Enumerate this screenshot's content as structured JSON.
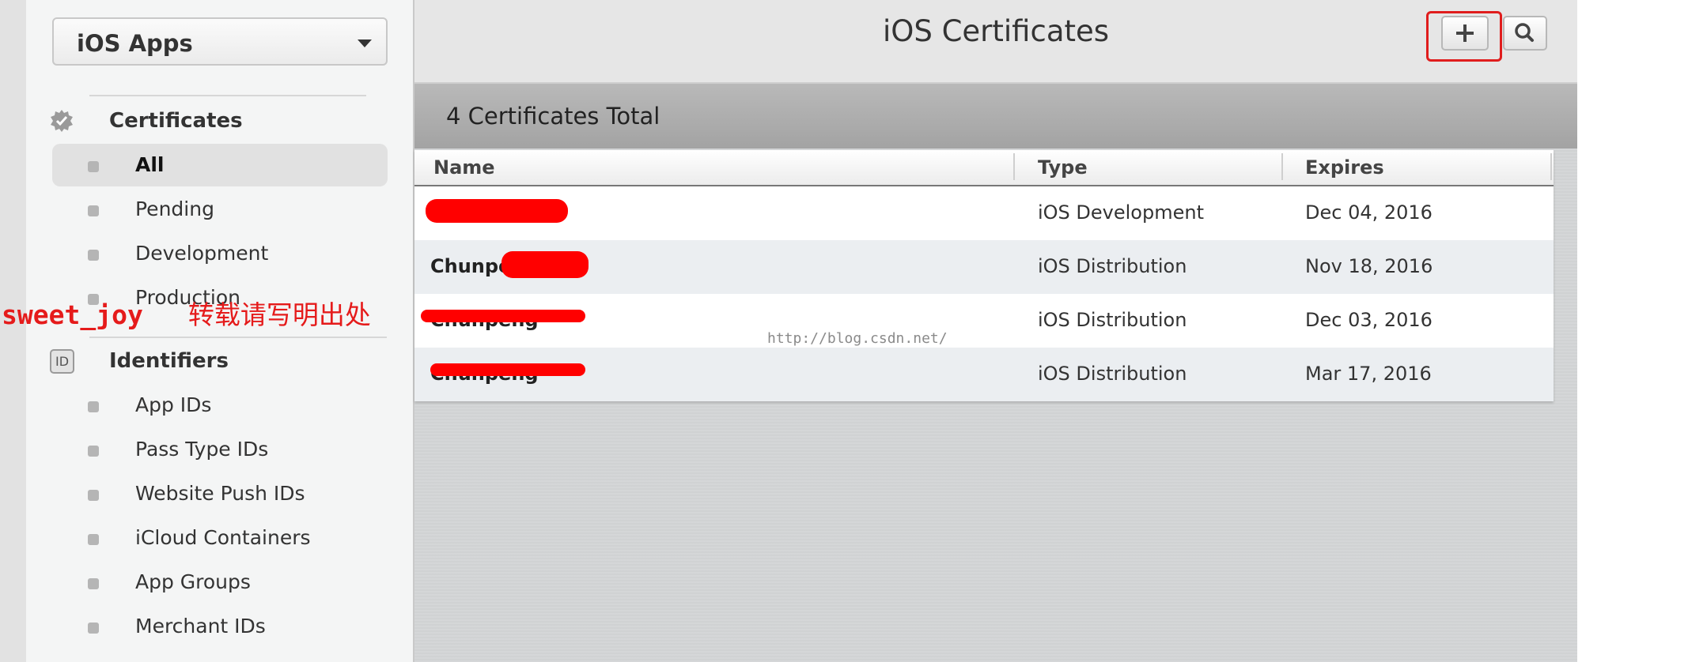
{
  "sidebar": {
    "app_select": {
      "value": "iOS Apps"
    },
    "certificates": {
      "label": "Certificates",
      "items": [
        {
          "label": "All",
          "active": true
        },
        {
          "label": "Pending"
        },
        {
          "label": "Development"
        },
        {
          "label": "Production"
        }
      ]
    },
    "identifiers": {
      "icon_text": "ID",
      "label": "Identifiers",
      "items": [
        {
          "label": "App IDs"
        },
        {
          "label": "Pass Type IDs"
        },
        {
          "label": "Website Push IDs"
        },
        {
          "label": "iCloud Containers"
        },
        {
          "label": "App Groups"
        },
        {
          "label": "Merchant IDs"
        }
      ]
    }
  },
  "header": {
    "title": "iOS Certificates",
    "add_icon": "plus-icon",
    "search_icon": "magnifier-icon",
    "highlight_color": "#e01d1d"
  },
  "summary": {
    "text": "4 Certificates Total"
  },
  "table": {
    "columns": [
      "Name",
      "Type",
      "Expires"
    ],
    "rows": [
      {
        "name": "",
        "type": "iOS Development",
        "expires": "Dec 04, 2016"
      },
      {
        "name": "Chunpeng",
        "type": "iOS Distribution",
        "expires": "Nov 18, 2016"
      },
      {
        "name": "Chunpeng",
        "type": "iOS Distribution",
        "expires": "Dec 03, 2016"
      },
      {
        "name": "Chunpeng",
        "type": "iOS Distribution",
        "expires": "Mar 17, 2016"
      }
    ]
  },
  "overlay": {
    "blog_url": "http://blog.csdn.net/",
    "watermark_name": "sweet_joy",
    "watermark_note": "转载请写明出处",
    "redaction_color": "#ff0000"
  }
}
